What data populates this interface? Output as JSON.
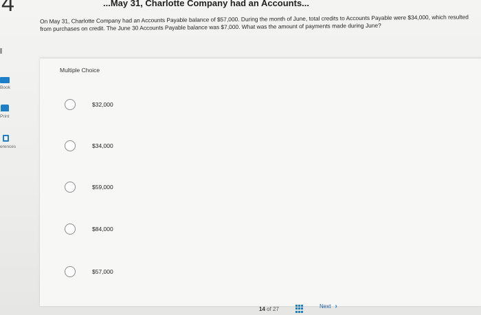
{
  "header": {
    "question_number": "4",
    "title_fragment": "...May 31, Charlotte Company had an Accounts..."
  },
  "question": {
    "text": "On May 31, Charlotte Company had an Accounts Payable balance of $57,000. During the month of June, total credits to Accounts Payable were $34,000, which resulted from purchases on credit. The June 30 Accounts Payable balance was $7,000. What was the amount of payments made during June?"
  },
  "sidebar": {
    "items": [
      {
        "label": "Book",
        "icon": "book-icon"
      },
      {
        "label": "Print",
        "icon": "print-icon"
      },
      {
        "label": "erences",
        "icon": "references-icon"
      }
    ]
  },
  "answer_panel": {
    "type_label": "Multiple Choice",
    "options": [
      {
        "label": "$32,000"
      },
      {
        "label": "$34,000"
      },
      {
        "label": "$59,000"
      },
      {
        "label": "$84,000"
      },
      {
        "label": "$57,000"
      }
    ]
  },
  "nav": {
    "current_page": "14",
    "of_label": "of",
    "total_pages": "27",
    "next_label": "Next",
    "next_icon": "chevron-right-icon",
    "grid_icon": "grid-icon"
  },
  "colors": {
    "accent": "#1c7fc8",
    "background": "#eeeeec",
    "panel": "#f7f7f6"
  }
}
